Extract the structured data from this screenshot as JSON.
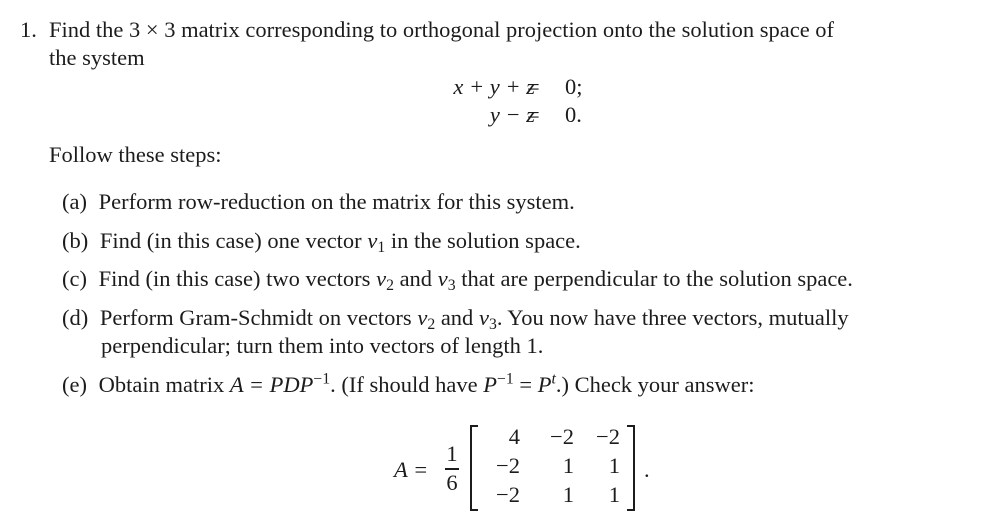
{
  "problem": {
    "number": "1.",
    "intro_line1": "Find the 3 × 3 matrix corresponding to orthogonal projection onto the solution space of",
    "intro_line2": "the system",
    "system": [
      {
        "lhs": "x + y + z",
        "eq": "=",
        "rhs": "0;"
      },
      {
        "lhs": "y − z",
        "eq": "=",
        "rhs": "0."
      }
    ],
    "follow": "Follow these steps:",
    "steps": [
      {
        "label": "(a)",
        "text": "Perform row-reduction on the matrix for this system."
      },
      {
        "label": "(b)",
        "text_before": "Find (in this case) one vector ",
        "var": "v",
        "sub": "1",
        "text_after": " in the solution space."
      },
      {
        "label": "(c)",
        "text_before": "Find (in this case) two vectors ",
        "var1": "v",
        "sub1": "2",
        "mid": " and ",
        "var2": "v",
        "sub2": "3",
        "text_after": " that are perpendicular to the solution space."
      },
      {
        "label": "(d)",
        "text_before": "Perform Gram-Schmidt on vectors ",
        "var1": "v",
        "sub1": "2",
        "mid": " and ",
        "var2": "v",
        "sub2": "3",
        "text_after": ". You now have three vectors, mutually",
        "line2": "perpendicular; turn them into vectors of length 1."
      },
      {
        "label": "(e)",
        "text_before": "Obtain matrix ",
        "eq1": "A = PDP",
        "exp1": "−1",
        "text_mid": ". (If should have ",
        "p1": "P",
        "exp2": "−1",
        "eqsign": " = ",
        "p2": "P",
        "exp3": "t",
        "text_after": ".) Check your answer:"
      }
    ],
    "answer": {
      "lhs": "A =",
      "frac_num": "1",
      "frac_den": "6",
      "matrix": [
        [
          "4",
          "−2",
          "−2"
        ],
        [
          "−2",
          "1",
          "1"
        ],
        [
          "−2",
          "1",
          "1"
        ]
      ],
      "end": "."
    }
  }
}
